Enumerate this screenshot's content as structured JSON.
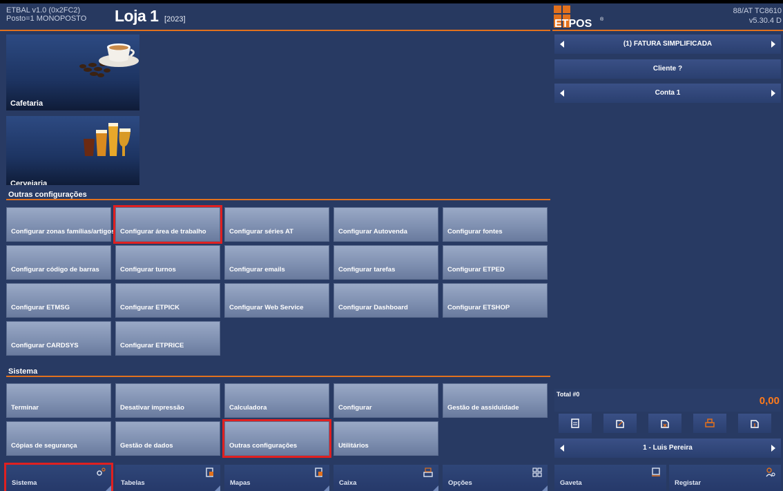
{
  "header": {
    "version_left": "ETBAL v1.0 (0x2FC2)",
    "posto": "Posto=1 MONOPOSTO",
    "store_title": "Loja 1",
    "store_year": "[2023]",
    "logo_text": "ETPOS",
    "version_right_1": "88/AT TC8610",
    "version_right_2": "v5.30.4 D"
  },
  "categories": [
    {
      "label": "Cafetaria",
      "icon": "coffee-cup-icon"
    },
    {
      "label": "Cervejaria",
      "icon": "beer-glasses-icon"
    }
  ],
  "sections": {
    "outras": {
      "title": "Outras configurações",
      "buttons": [
        "Configurar zonas famílias/artigos",
        "Configurar área de trabalho",
        "Configurar séries AT",
        "Configurar Autovenda",
        "Configurar fontes",
        "Configurar código de barras",
        "Configurar turnos",
        "Configurar emails",
        "Configurar tarefas",
        "Configurar ETPED",
        "Configurar ETMSG",
        "Configurar ETPICK",
        "Configurar Web Service",
        "Configurar Dashboard",
        "Configurar ETSHOP",
        "Configurar CARDSYS",
        "Configurar ETPRICE"
      ]
    },
    "sistema": {
      "title": "Sistema",
      "buttons": [
        "Terminar",
        "Desativar impressão",
        "Calculadora",
        "Configurar",
        "Gestão de assiduidade",
        "Cópias de segurança",
        "Gestão de dados",
        "Outras configurações",
        "Utilitários"
      ]
    }
  },
  "tabs": [
    {
      "label": "Sistema",
      "icon": "gears-icon"
    },
    {
      "label": "Tabelas",
      "icon": "table-doc-icon"
    },
    {
      "label": "Mapas",
      "icon": "map-doc-icon"
    },
    {
      "label": "Caixa",
      "icon": "cash-register-icon"
    },
    {
      "label": "Opções",
      "icon": "grid-icon"
    }
  ],
  "right_panel": {
    "doc_type": "(1) FATURA SIMPLIFICADA",
    "client": "Cliente ?",
    "account": "Conta 1",
    "total_label": "Total #0",
    "total_value": "0,00",
    "operator": "1 - Luis Pereira",
    "actions": [
      "document-icon",
      "edit-doc-icon",
      "cancel-doc-icon",
      "print-icon",
      "transfer-doc-icon"
    ],
    "tabs": [
      {
        "label": "Gaveta",
        "icon": "drawer-icon"
      },
      {
        "label": "Registar",
        "icon": "user-key-icon"
      }
    ]
  },
  "colors": {
    "background": "#283a63",
    "accent": "#e2711d",
    "highlight": "#e02020",
    "total": "#ff7a1a"
  }
}
